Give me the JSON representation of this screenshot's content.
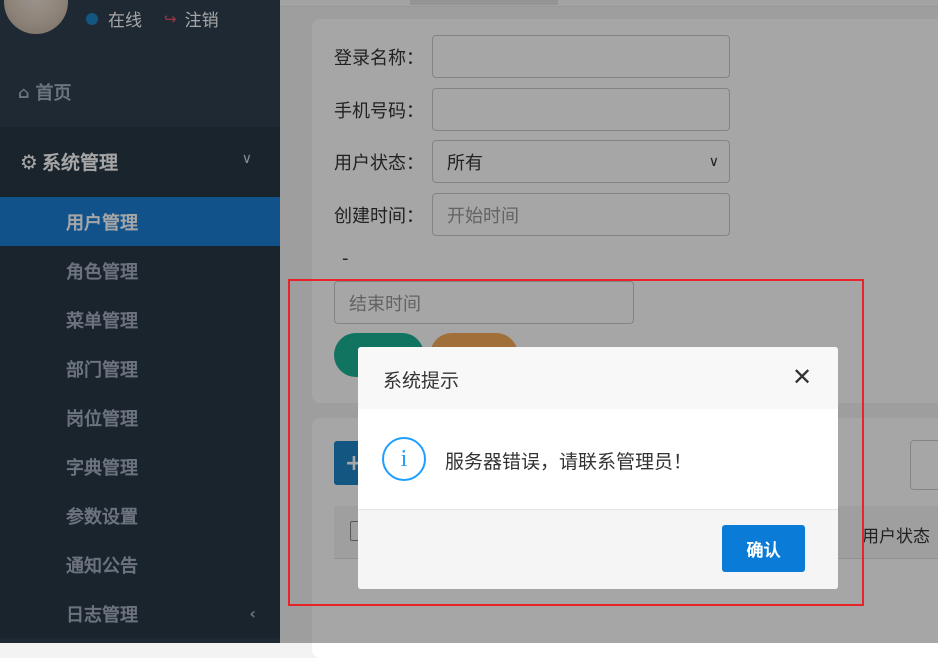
{
  "sidebar": {
    "status": {
      "online_label": "在线",
      "logout_label": "注销"
    },
    "home_label": "首页",
    "group_label": "系统管理",
    "items": [
      {
        "label": "用户管理",
        "active": true
      },
      {
        "label": "角色管理"
      },
      {
        "label": "菜单管理"
      },
      {
        "label": "部门管理"
      },
      {
        "label": "岗位管理"
      },
      {
        "label": "字典管理"
      },
      {
        "label": "参数设置"
      },
      {
        "label": "通知公告"
      },
      {
        "label": "日志管理"
      }
    ]
  },
  "search_form": {
    "login_name_label": "登录名称：",
    "phone_label": "手机号码：",
    "status_label": "用户状态：",
    "status_value": "所有",
    "created_label": "创建时间：",
    "start_placeholder": "开始时间",
    "range_separator": "-",
    "end_placeholder": "结束时间"
  },
  "table": {
    "status_header": "用户状态"
  },
  "dialog": {
    "title": "系统提示",
    "message": "服务器错误，请联系管理员！",
    "confirm_label": "确认"
  },
  "colors": {
    "sidebar_bg": "#2f4050",
    "active_item": "#1c7ed6",
    "highlight_border": "#e8232a",
    "confirm_button": "#0a7bd6"
  }
}
